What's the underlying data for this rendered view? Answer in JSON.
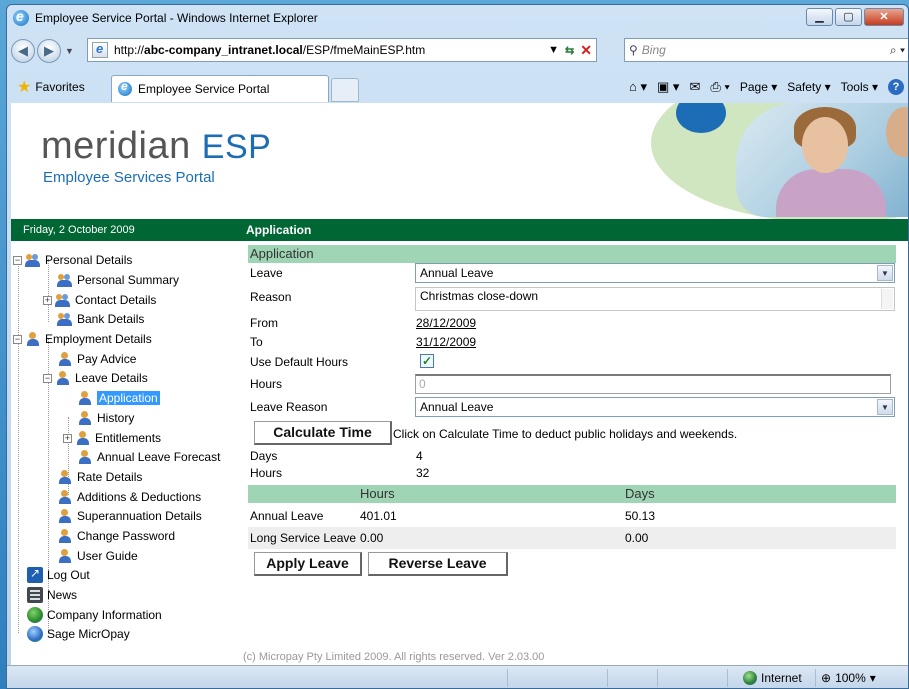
{
  "window": {
    "title": "Employee Service Portal - Windows Internet Explorer"
  },
  "browser": {
    "url_prefix": "http://",
    "url_host": "abc-company_intranet.local",
    "url_path": "/ESP/fmeMainESP.htm",
    "search_placeholder": "Bing",
    "favorites_label": "Favorites",
    "tab_title": "Employee Service Portal",
    "cmd_page": "Page ▾",
    "cmd_safety": "Safety ▾",
    "cmd_tools": "Tools ▾"
  },
  "header": {
    "logo_main": "meridian",
    "logo_accent": "ESP",
    "subtitle": "Employee Services Portal"
  },
  "bar": {
    "date": "Friday, 2 October 2009",
    "section": "Application"
  },
  "tree": [
    {
      "label": "Personal Details"
    },
    {
      "label": "Personal Summary"
    },
    {
      "label": "Contact Details"
    },
    {
      "label": "Bank Details"
    },
    {
      "label": "Employment Details"
    },
    {
      "label": "Pay Advice"
    },
    {
      "label": "Leave Details"
    },
    {
      "label": "Application"
    },
    {
      "label": "History"
    },
    {
      "label": "Entitlements"
    },
    {
      "label": "Annual Leave Forecast"
    },
    {
      "label": "Rate Details"
    },
    {
      "label": "Additions & Deductions"
    },
    {
      "label": "Superannuation Details"
    },
    {
      "label": "Change Password"
    },
    {
      "label": "User Guide"
    },
    {
      "label": "Log Out"
    },
    {
      "label": "News"
    },
    {
      "label": "Company Information"
    },
    {
      "label": "Sage MicrOpay"
    }
  ],
  "form": {
    "heading": "Application",
    "leave_label": "Leave",
    "leave_value": "Annual Leave",
    "reason_label": "Reason",
    "reason_value": "Christmas close-down",
    "from_label": "From",
    "from_value": "28/12/2009",
    "to_label": "To",
    "to_value": "31/12/2009",
    "default_hours_label": "Use Default Hours",
    "default_hours_checked": "✓",
    "hours_label": "Hours",
    "hours_value": "0",
    "leave_reason_label": "Leave Reason",
    "leave_reason_value": "Annual Leave",
    "calc_button": "Calculate Time",
    "calc_note": "Click on Calculate Time to deduct public holidays and weekends.",
    "days_label": "Days",
    "days_value": "4",
    "hours_result_label": "Hours",
    "hours_result_value": "32"
  },
  "balances": {
    "col_hours": "Hours",
    "col_days": "Days",
    "rows": [
      {
        "type": "Annual Leave",
        "hours": "401.01",
        "days": "50.13"
      },
      {
        "type": "Long Service Leave",
        "hours": "0.00",
        "days": "0.00"
      }
    ]
  },
  "actions": {
    "apply": "Apply Leave",
    "reverse": "Reverse Leave"
  },
  "footer": {
    "copyright": "(c) Micropay Pty Limited 2009. All rights reserved. Ver 2.03.00"
  },
  "status": {
    "zone": "Internet",
    "zoom": "100%"
  }
}
